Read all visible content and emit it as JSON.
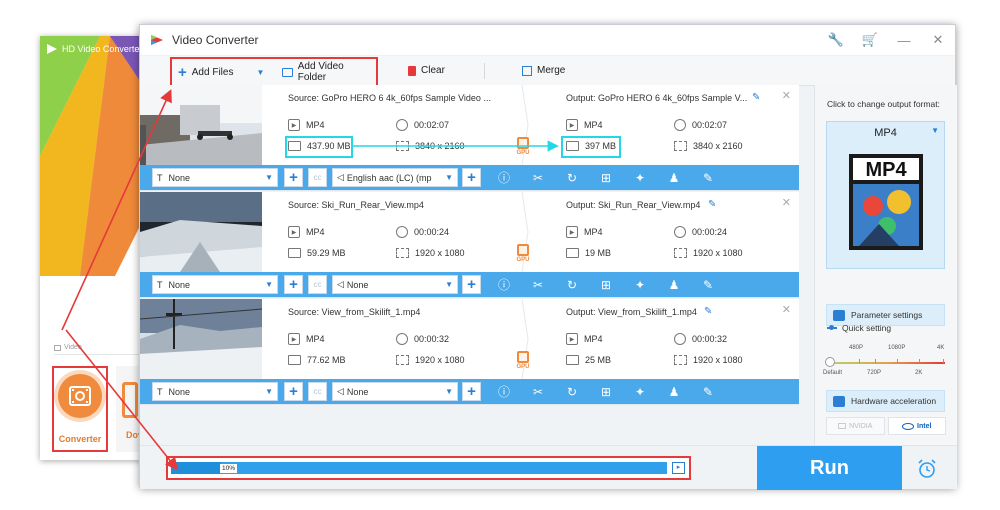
{
  "background_window": {
    "title": "HD Video Converte",
    "section_label": "Video",
    "tiles": [
      {
        "label": "Converter"
      },
      {
        "label": "Dov"
      }
    ]
  },
  "window": {
    "title": "Video Converter",
    "controls": [
      "wrench-icon",
      "cart-icon",
      "minimize-icon",
      "close-icon"
    ]
  },
  "toolbar": {
    "add_files": "Add Files",
    "add_folder": "Add Video Folder",
    "clear": "Clear",
    "merge": "Merge"
  },
  "files": [
    {
      "source": "Source: GoPro HERO 6 4k_60fps Sample  Video ...",
      "output": "Output: GoPro HERO 6 4k_60fps Sample  V...",
      "src_format": "MP4",
      "src_duration": "00:02:07",
      "src_size": "437.90 MB",
      "src_res": "3840 x 2160",
      "out_format": "MP4",
      "out_duration": "00:02:07",
      "out_size": "397 MB",
      "out_res": "3840 x 2160",
      "subtitle": "None",
      "audio": "English aac (LC) (mp",
      "gpu": "GPU"
    },
    {
      "source": "Source: Ski_Run_Rear_View.mp4",
      "output": "Output: Ski_Run_Rear_View.mp4",
      "src_format": "MP4",
      "src_duration": "00:00:24",
      "src_size": "59.29 MB",
      "src_res": "1920 x 1080",
      "out_format": "MP4",
      "out_duration": "00:00:24",
      "out_size": "19 MB",
      "out_res": "1920 x 1080",
      "subtitle": "None",
      "audio": "None",
      "gpu": "GPU"
    },
    {
      "source": "Source: View_from_Skilift_1.mp4",
      "output": "Output: View_from_Skilift_1.mp4",
      "src_format": "MP4",
      "src_duration": "00:00:32",
      "src_size": "77.62 MB",
      "src_res": "1920 x 1080",
      "out_format": "MP4",
      "out_duration": "00:00:32",
      "out_size": "25 MB",
      "out_res": "1920 x 1080",
      "subtitle": "None",
      "audio": "None",
      "gpu": "GPU"
    }
  ],
  "item_bar_icons": [
    "info-icon",
    "cut-icon",
    "rotate-icon",
    "crop-icon",
    "effects-icon",
    "watermark-icon",
    "edit-icon"
  ],
  "right_panel": {
    "change_format_label": "Click to change output format:",
    "format": "MP4",
    "format_art_text": "MP4",
    "parameter_settings": "Parameter settings",
    "quick_setting": "Quick setting",
    "quality_top": [
      "480P",
      "1080P",
      "4K"
    ],
    "quality_bottom": [
      "Default",
      "720P",
      "2K"
    ],
    "hardware_acceleration": "Hardware acceleration",
    "vendors": [
      "NVIDIA",
      "Intel"
    ]
  },
  "bottom": {
    "progress_percent": 10,
    "progress_text": "10%",
    "run": "Run"
  },
  "colors": {
    "accent_blue": "#2e9ef0",
    "annotation_red": "#e5393a",
    "highlight_cyan": "#22d7e6",
    "brand_orange": "#f08a3c"
  }
}
